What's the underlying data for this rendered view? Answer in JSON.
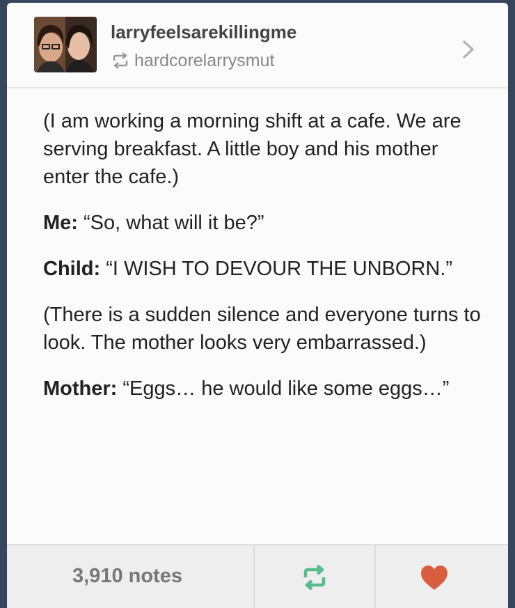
{
  "post": {
    "username": "larryfeelsarekillingme",
    "reblogged_from": "hardcorelarrysmut",
    "paragraphs": [
      {
        "speaker": "",
        "text": "(I am working a morning shift at a cafe. We are serving breakfast. A little boy and his mother enter the cafe.)"
      },
      {
        "speaker": "Me:",
        "text": " “So, what will it be?”"
      },
      {
        "speaker": "Child:",
        "text": " “I WISH TO DEVOUR THE UNBORN.”"
      },
      {
        "speaker": "",
        "text": "(There is a sudden silence and everyone turns to look. The mother looks very embarrassed.)"
      },
      {
        "speaker": "Mother:",
        "text": " “Eggs… he would like some eggs…”"
      }
    ]
  },
  "footer": {
    "notes": "3,910 notes"
  },
  "icons": {
    "reblog": "reblog-icon",
    "like": "heart-icon",
    "navigate": "chevron-right-icon",
    "avatar": "avatar"
  },
  "colors": {
    "background": "#36465d",
    "reblog_green": "#56bc8a",
    "like_red": "#d95e40"
  }
}
